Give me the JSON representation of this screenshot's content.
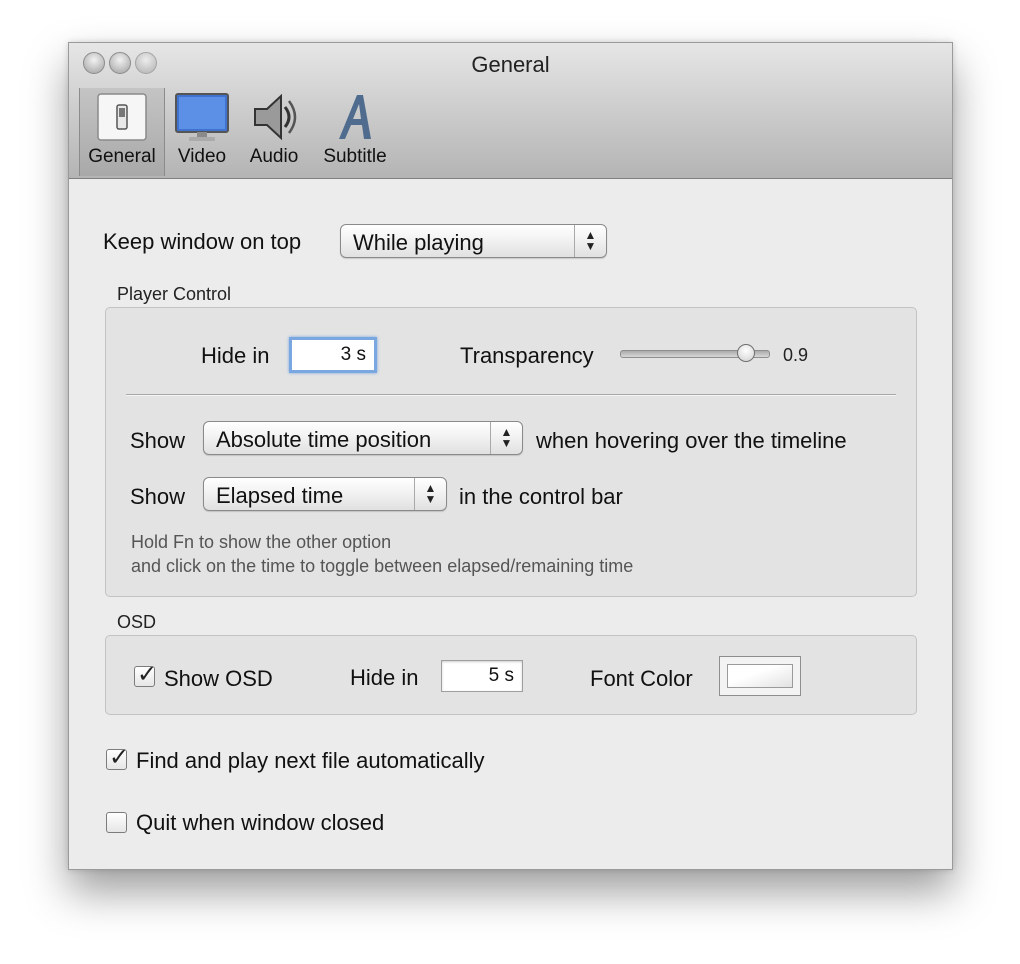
{
  "window": {
    "title": "General"
  },
  "tabs": [
    {
      "label": "General",
      "icon": "toggle-switch-icon",
      "selected": true
    },
    {
      "label": "Video",
      "icon": "monitor-icon",
      "selected": false
    },
    {
      "label": "Audio",
      "icon": "speaker-icon",
      "selected": false
    },
    {
      "label": "Subtitle",
      "icon": "letter-a-icon",
      "selected": false
    }
  ],
  "keep_on_top": {
    "label": "Keep window on top",
    "value": "While playing"
  },
  "player_control": {
    "title": "Player Control",
    "hide_label": "Hide in",
    "hide_value": "3 s",
    "transparency_label": "Transparency",
    "transparency_value": "0.9",
    "transparency_fraction": 0.9,
    "show1_label": "Show",
    "show1_value": "Absolute time position",
    "show1_suffix": "when hovering over the timeline",
    "show2_label": "Show",
    "show2_value": "Elapsed time",
    "show2_suffix": "in the control bar",
    "hint_line1": "Hold Fn to show the other option",
    "hint_line2": "and click on the time to toggle between elapsed/remaining time"
  },
  "osd": {
    "title": "OSD",
    "show_label": "Show OSD",
    "show_checked": true,
    "hide_label": "Hide in",
    "hide_value": "5 s",
    "font_color_label": "Font Color"
  },
  "options": {
    "find_next_label": "Find and play next file automatically",
    "find_next_checked": true,
    "quit_label": "Quit when window closed",
    "quit_checked": false
  },
  "glyphs": {
    "check": "✓",
    "up": "▲",
    "down": "▼"
  }
}
